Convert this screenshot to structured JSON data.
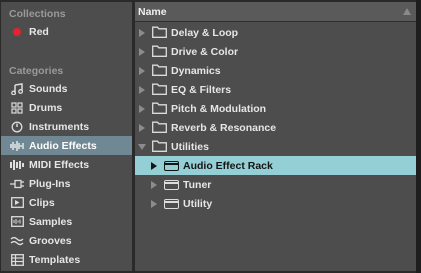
{
  "sidebar": {
    "collections_header": "Collections",
    "collections": [
      {
        "label": "Red",
        "icon": "red-color-dot-icon",
        "color": "#e5222f"
      }
    ],
    "categories_header": "Categories",
    "categories": [
      {
        "label": "Sounds",
        "icon": "sounds-icon"
      },
      {
        "label": "Drums",
        "icon": "drums-icon"
      },
      {
        "label": "Instruments",
        "icon": "instruments-icon"
      },
      {
        "label": "Audio Effects",
        "icon": "audio-effects-icon",
        "selected": true
      },
      {
        "label": "MIDI Effects",
        "icon": "midi-effects-icon"
      },
      {
        "label": "Plug-Ins",
        "icon": "plug-ins-icon"
      },
      {
        "label": "Clips",
        "icon": "clips-icon"
      },
      {
        "label": "Samples",
        "icon": "samples-icon"
      },
      {
        "label": "Grooves",
        "icon": "grooves-icon"
      },
      {
        "label": "Templates",
        "icon": "templates-icon"
      }
    ]
  },
  "browser": {
    "column_header": "Name",
    "sort_icon": "sort-ascending-icon",
    "items": [
      {
        "label": "Delay & Loop",
        "expanded": false
      },
      {
        "label": "Drive & Color",
        "expanded": false
      },
      {
        "label": "Dynamics",
        "expanded": false
      },
      {
        "label": "EQ & Filters",
        "expanded": false
      },
      {
        "label": "Pitch & Modulation",
        "expanded": false
      },
      {
        "label": "Reverb & Resonance",
        "expanded": false
      },
      {
        "label": "Utilities",
        "expanded": true
      },
      {
        "label": "Audio Effect Rack",
        "child": true,
        "selected": true
      },
      {
        "label": "Tuner",
        "child": true
      },
      {
        "label": "Utility",
        "child": true
      }
    ]
  },
  "colors": {
    "panel": "#4d4d4d",
    "sidebar_selected": "#6f8893",
    "browser_selected": "#94cfd6",
    "collection_red": "#e5222f"
  }
}
